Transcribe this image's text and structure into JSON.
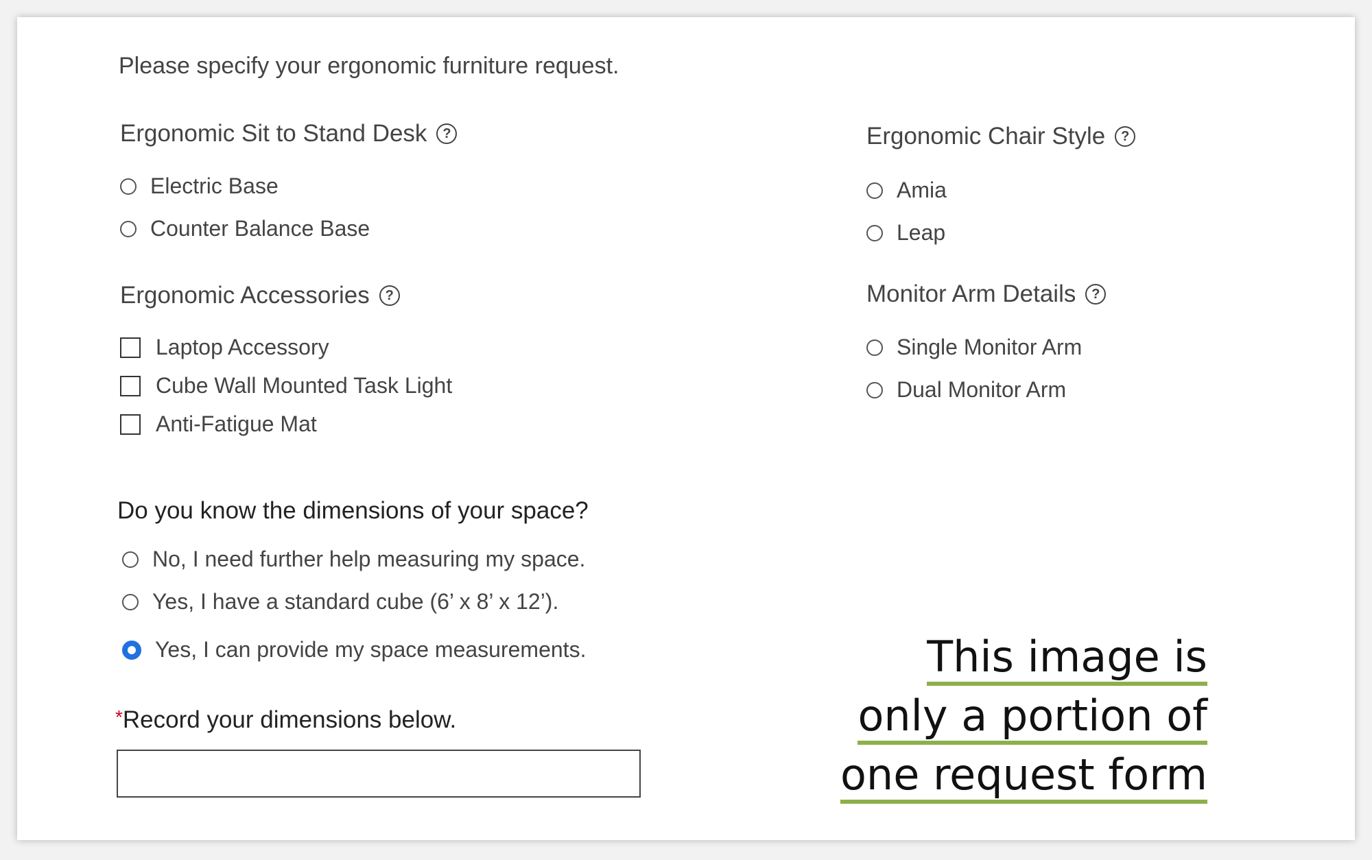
{
  "form": {
    "intro": "Please specify your ergonomic furniture request.",
    "desk": {
      "title": "Ergonomic Sit to Stand Desk",
      "help": "?",
      "options": [
        "Electric Base",
        "Counter Balance Base"
      ]
    },
    "accessories": {
      "title": "Ergonomic Accessories",
      "help": "?",
      "options": [
        "Laptop Accessory",
        "Cube Wall Mounted Task Light",
        "Anti-Fatigue Mat"
      ]
    },
    "chair": {
      "title": "Ergonomic Chair Style",
      "help": "?",
      "options": [
        "Amia",
        "Leap"
      ]
    },
    "monitor": {
      "title": "Monitor Arm Details",
      "help": "?",
      "options": [
        "Single Monitor Arm",
        "Dual Monitor Arm"
      ]
    },
    "dimensions": {
      "question": "Do you know the dimensions of your space?",
      "options": [
        "No, I need further help measuring my space.",
        "Yes, I have a standard cube (6’ x 8’ x 12’).",
        "Yes, I can provide my space measurements."
      ],
      "selected_option": "Yes, I can provide my space measurements."
    },
    "record": {
      "required_mark": "*",
      "label": "Record your dimensions below.",
      "value": ""
    }
  },
  "annotation": {
    "lines": [
      "This image is",
      "only a portion of",
      "one request form"
    ],
    "underline_color": "#8cb04a"
  },
  "colors": {
    "radio_selected": "#1f72e0",
    "required": "#d0021b"
  },
  "icons": {
    "help": "question-circle-icon"
  }
}
